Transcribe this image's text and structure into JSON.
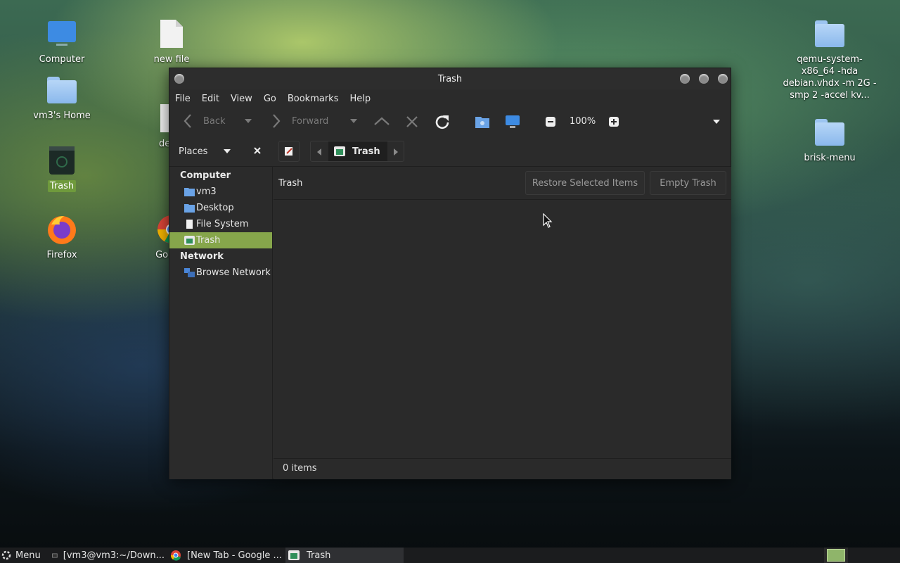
{
  "desktop": {
    "icons": [
      {
        "label": "Computer",
        "icon": "computer-icon"
      },
      {
        "label": "new file",
        "icon": "file-icon"
      },
      {
        "label": "vm3's Home",
        "icon": "home-folder-icon"
      },
      {
        "label": "debia",
        "icon": "file-icon"
      },
      {
        "label": "Trash",
        "icon": "trash-icon"
      },
      {
        "label": "Firefox",
        "icon": "firefox-icon"
      },
      {
        "label": "Google",
        "icon": "chrome-icon"
      },
      {
        "label": "qemu-system-x86_64 -hda debian.vhdx -m 2G -smp 2 -accel kv...",
        "icon": "folder-icon"
      },
      {
        "label": "brisk-menu",
        "icon": "folder-icon"
      }
    ]
  },
  "window": {
    "title": "Trash",
    "menu": [
      "File",
      "Edit",
      "View",
      "Go",
      "Bookmarks",
      "Help"
    ],
    "toolbar": {
      "back_label": "Back",
      "forward_label": "Forward",
      "zoom": "100%"
    },
    "location": {
      "places_label": "Places",
      "crumb": "Trash"
    },
    "sidebar": {
      "computer_heading": "Computer",
      "computer_items": [
        "vm3",
        "Desktop",
        "File System",
        "Trash"
      ],
      "network_heading": "Network",
      "network_items": [
        "Browse Network"
      ],
      "selected": "Trash"
    },
    "content": {
      "info_label": "Trash",
      "restore_button": "Restore Selected Items",
      "empty_button": "Empty Trash",
      "status": "0 items"
    }
  },
  "taskbar": {
    "menu_label": "Menu",
    "tasks": [
      {
        "label": "[vm3@vm3:~/Down...",
        "icon": "terminal-icon"
      },
      {
        "label": "[New Tab - Google ...",
        "icon": "chrome-icon"
      },
      {
        "label": "Trash",
        "icon": "trash-icon"
      }
    ]
  }
}
